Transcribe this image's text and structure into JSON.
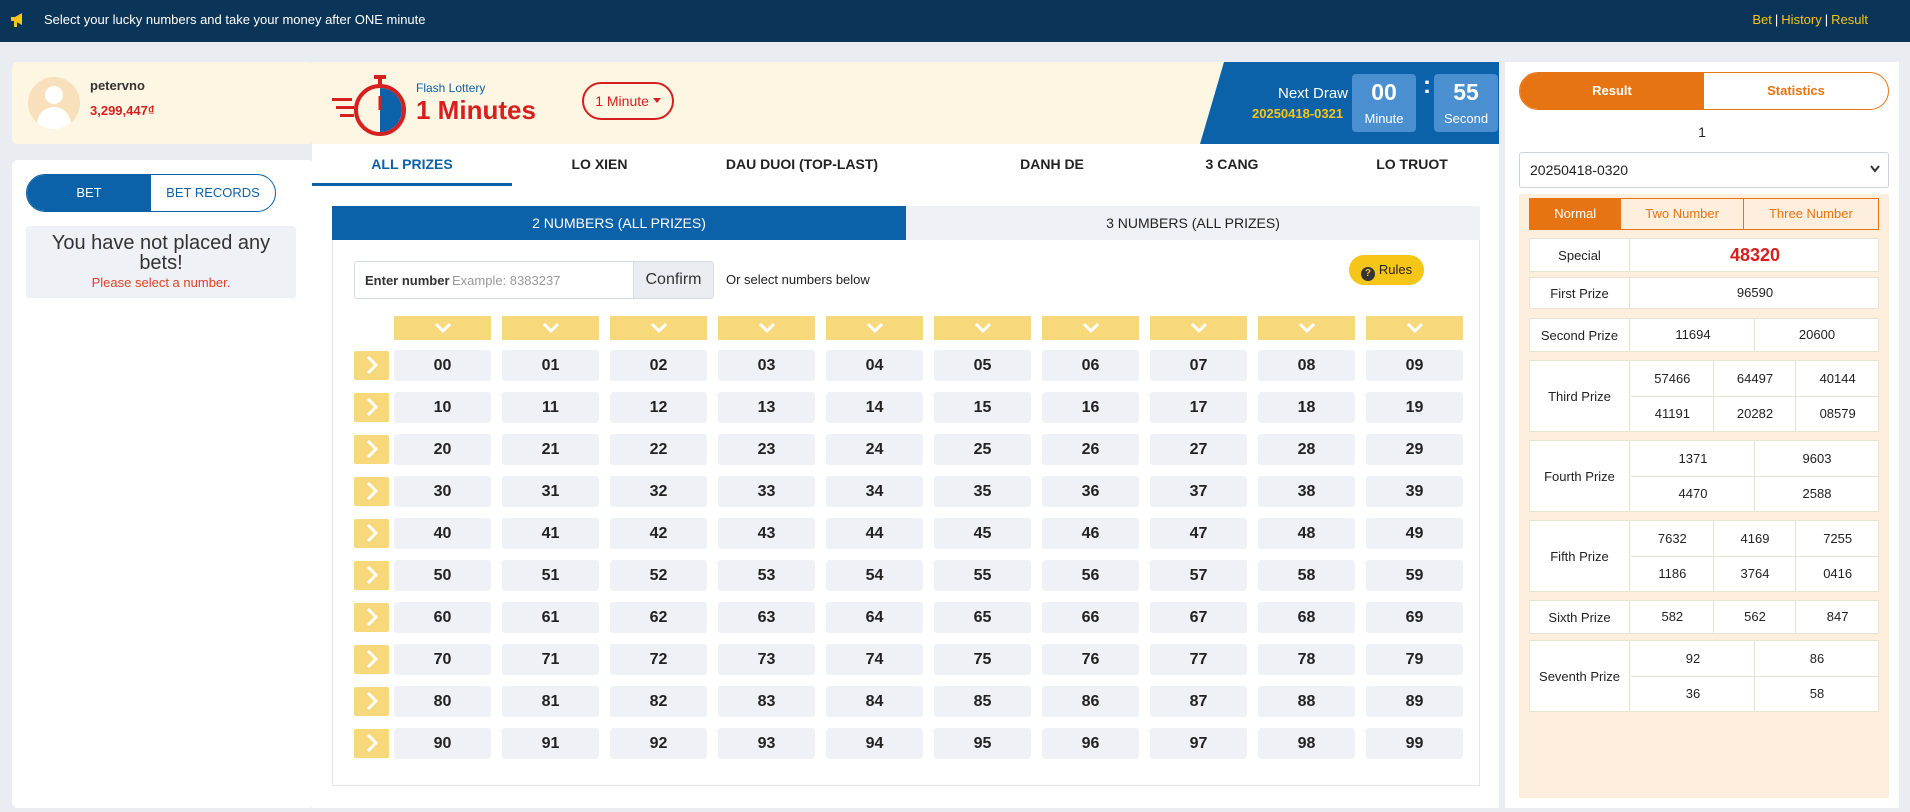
{
  "topbar": {
    "icon": "megaphone-icon",
    "message": "Select your lucky numbers and take your money after ONE minute",
    "links": [
      "Bet",
      "History",
      "Result"
    ],
    "link_color": "#f5c518"
  },
  "user": {
    "name": "petervno",
    "balance": "3,299,447₫"
  },
  "left": {
    "tabs": [
      "BET",
      "BET RECORDS"
    ],
    "empty_title": "You have not placed any bets!",
    "empty_hint": "Please select a number."
  },
  "game": {
    "brand_small": "Flash Lottery",
    "brand_large": "1 Minutes",
    "duration_select": "1 Minute",
    "next_draw_label": "Next Draw",
    "next_draw_id": "20250418-0321",
    "countdown": {
      "minute": "00",
      "minute_label": "Minute",
      "second": "55",
      "second_label": "Second"
    },
    "tabs": [
      "ALL PRIZES",
      "LO XIEN",
      "DAU DUOI (TOP-LAST)",
      "DANH DE",
      "3 CANG",
      "LO TRUOT"
    ],
    "subtabs": [
      "2 NUMBERS (ALL PRIZES)",
      "3 NUMBERS (ALL PRIZES)"
    ],
    "enter_label": "Enter number",
    "enter_placeholder": "Example: 8383237",
    "confirm": "Confirm",
    "or_select": "Or select numbers below",
    "rules": "Rules",
    "numbers": [
      [
        "00",
        "01",
        "02",
        "03",
        "04",
        "05",
        "06",
        "07",
        "08",
        "09"
      ],
      [
        "10",
        "11",
        "12",
        "13",
        "14",
        "15",
        "16",
        "17",
        "18",
        "19"
      ],
      [
        "20",
        "21",
        "22",
        "23",
        "24",
        "25",
        "26",
        "27",
        "28",
        "29"
      ],
      [
        "30",
        "31",
        "32",
        "33",
        "34",
        "35",
        "36",
        "37",
        "38",
        "39"
      ],
      [
        "40",
        "41",
        "42",
        "43",
        "44",
        "45",
        "46",
        "47",
        "48",
        "49"
      ],
      [
        "50",
        "51",
        "52",
        "53",
        "54",
        "55",
        "56",
        "57",
        "58",
        "59"
      ],
      [
        "60",
        "61",
        "62",
        "63",
        "64",
        "65",
        "66",
        "67",
        "68",
        "69"
      ],
      [
        "70",
        "71",
        "72",
        "73",
        "74",
        "75",
        "76",
        "77",
        "78",
        "79"
      ],
      [
        "80",
        "81",
        "82",
        "83",
        "84",
        "85",
        "86",
        "87",
        "88",
        "89"
      ],
      [
        "90",
        "91",
        "92",
        "93",
        "94",
        "95",
        "96",
        "97",
        "98",
        "99"
      ]
    ]
  },
  "results": {
    "tabs": [
      "Result",
      "Statistics"
    ],
    "selected_index": "1",
    "period": "20250418-0320",
    "modes": [
      "Normal",
      "Two Number",
      "Three Number"
    ],
    "prizes": {
      "special": {
        "label": "Special",
        "values": [
          "48320"
        ]
      },
      "first": {
        "label": "First Prize",
        "values": [
          "96590"
        ]
      },
      "second": {
        "label": "Second Prize",
        "values": [
          "11694",
          "20600"
        ]
      },
      "third": {
        "label": "Third Prize",
        "values": [
          "57466",
          "64497",
          "40144",
          "41191",
          "20282",
          "08579"
        ]
      },
      "fourth": {
        "label": "Fourth Prize",
        "values": [
          "1371",
          "9603",
          "4470",
          "2588"
        ]
      },
      "fifth": {
        "label": "Fifth Prize",
        "values": [
          "7632",
          "4169",
          "7255",
          "1186",
          "3764",
          "0416"
        ]
      },
      "sixth": {
        "label": "Sixth Prize",
        "values": [
          "582",
          "562",
          "847"
        ]
      },
      "seventh": {
        "label": "Seventh Prize",
        "values": [
          "92",
          "86",
          "36",
          "58"
        ]
      }
    }
  },
  "colors": {
    "navy": "#0b3558",
    "blue": "#0b62a8",
    "red": "#d62020",
    "orange": "#e67412",
    "yellow": "#f7d87a"
  }
}
